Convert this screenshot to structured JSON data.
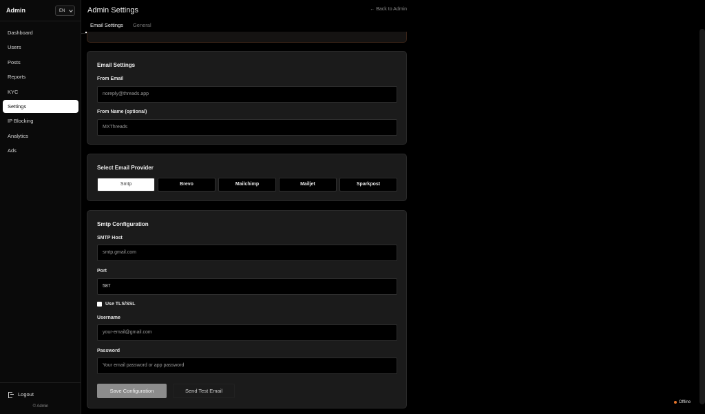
{
  "sidebar": {
    "title": "Admin",
    "language": "EN",
    "items": [
      {
        "label": "Dashboard",
        "active": false
      },
      {
        "label": "Users",
        "active": false
      },
      {
        "label": "Posts",
        "active": false
      },
      {
        "label": "Reports",
        "active": false
      },
      {
        "label": "KYC",
        "active": false
      },
      {
        "label": "Settings",
        "active": true
      },
      {
        "label": "IP Blocking",
        "active": false
      },
      {
        "label": "Analytics",
        "active": false
      },
      {
        "label": "Ads",
        "active": false
      }
    ],
    "logout_label": "Logout",
    "footer": "© Admin"
  },
  "header": {
    "title": "Admin Settings",
    "back_link": "← Back to Admin",
    "tabs": [
      {
        "label": "Email Settings",
        "active": true
      },
      {
        "label": "General",
        "active": false
      }
    ]
  },
  "email_settings": {
    "title": "Email Settings",
    "from_email_label": "From Email",
    "from_email_placeholder": "noreply@threads.app",
    "from_name_label": "From Name (optional)",
    "from_name_placeholder": "MXThreads"
  },
  "provider": {
    "title": "Select Email Provider",
    "options": [
      "Smtp",
      "Brevo",
      "Mailchimp",
      "Mailjet",
      "Sparkpost"
    ],
    "selected": "Smtp"
  },
  "smtp": {
    "title": "Smtp Configuration",
    "host_label": "SMTP Host",
    "host_placeholder": "smtp.gmail.com",
    "port_label": "Port",
    "port_value": "587",
    "tls_label": "Use TLS/SSL",
    "tls_checked": false,
    "username_label": "Username",
    "username_placeholder": "your-email@gmail.com",
    "password_label": "Password",
    "password_placeholder": "Your email password or app password",
    "save_label": "Save Configuration",
    "test_label": "Send Test Email"
  },
  "status": {
    "label": "Offline",
    "color": "#e8752a"
  }
}
